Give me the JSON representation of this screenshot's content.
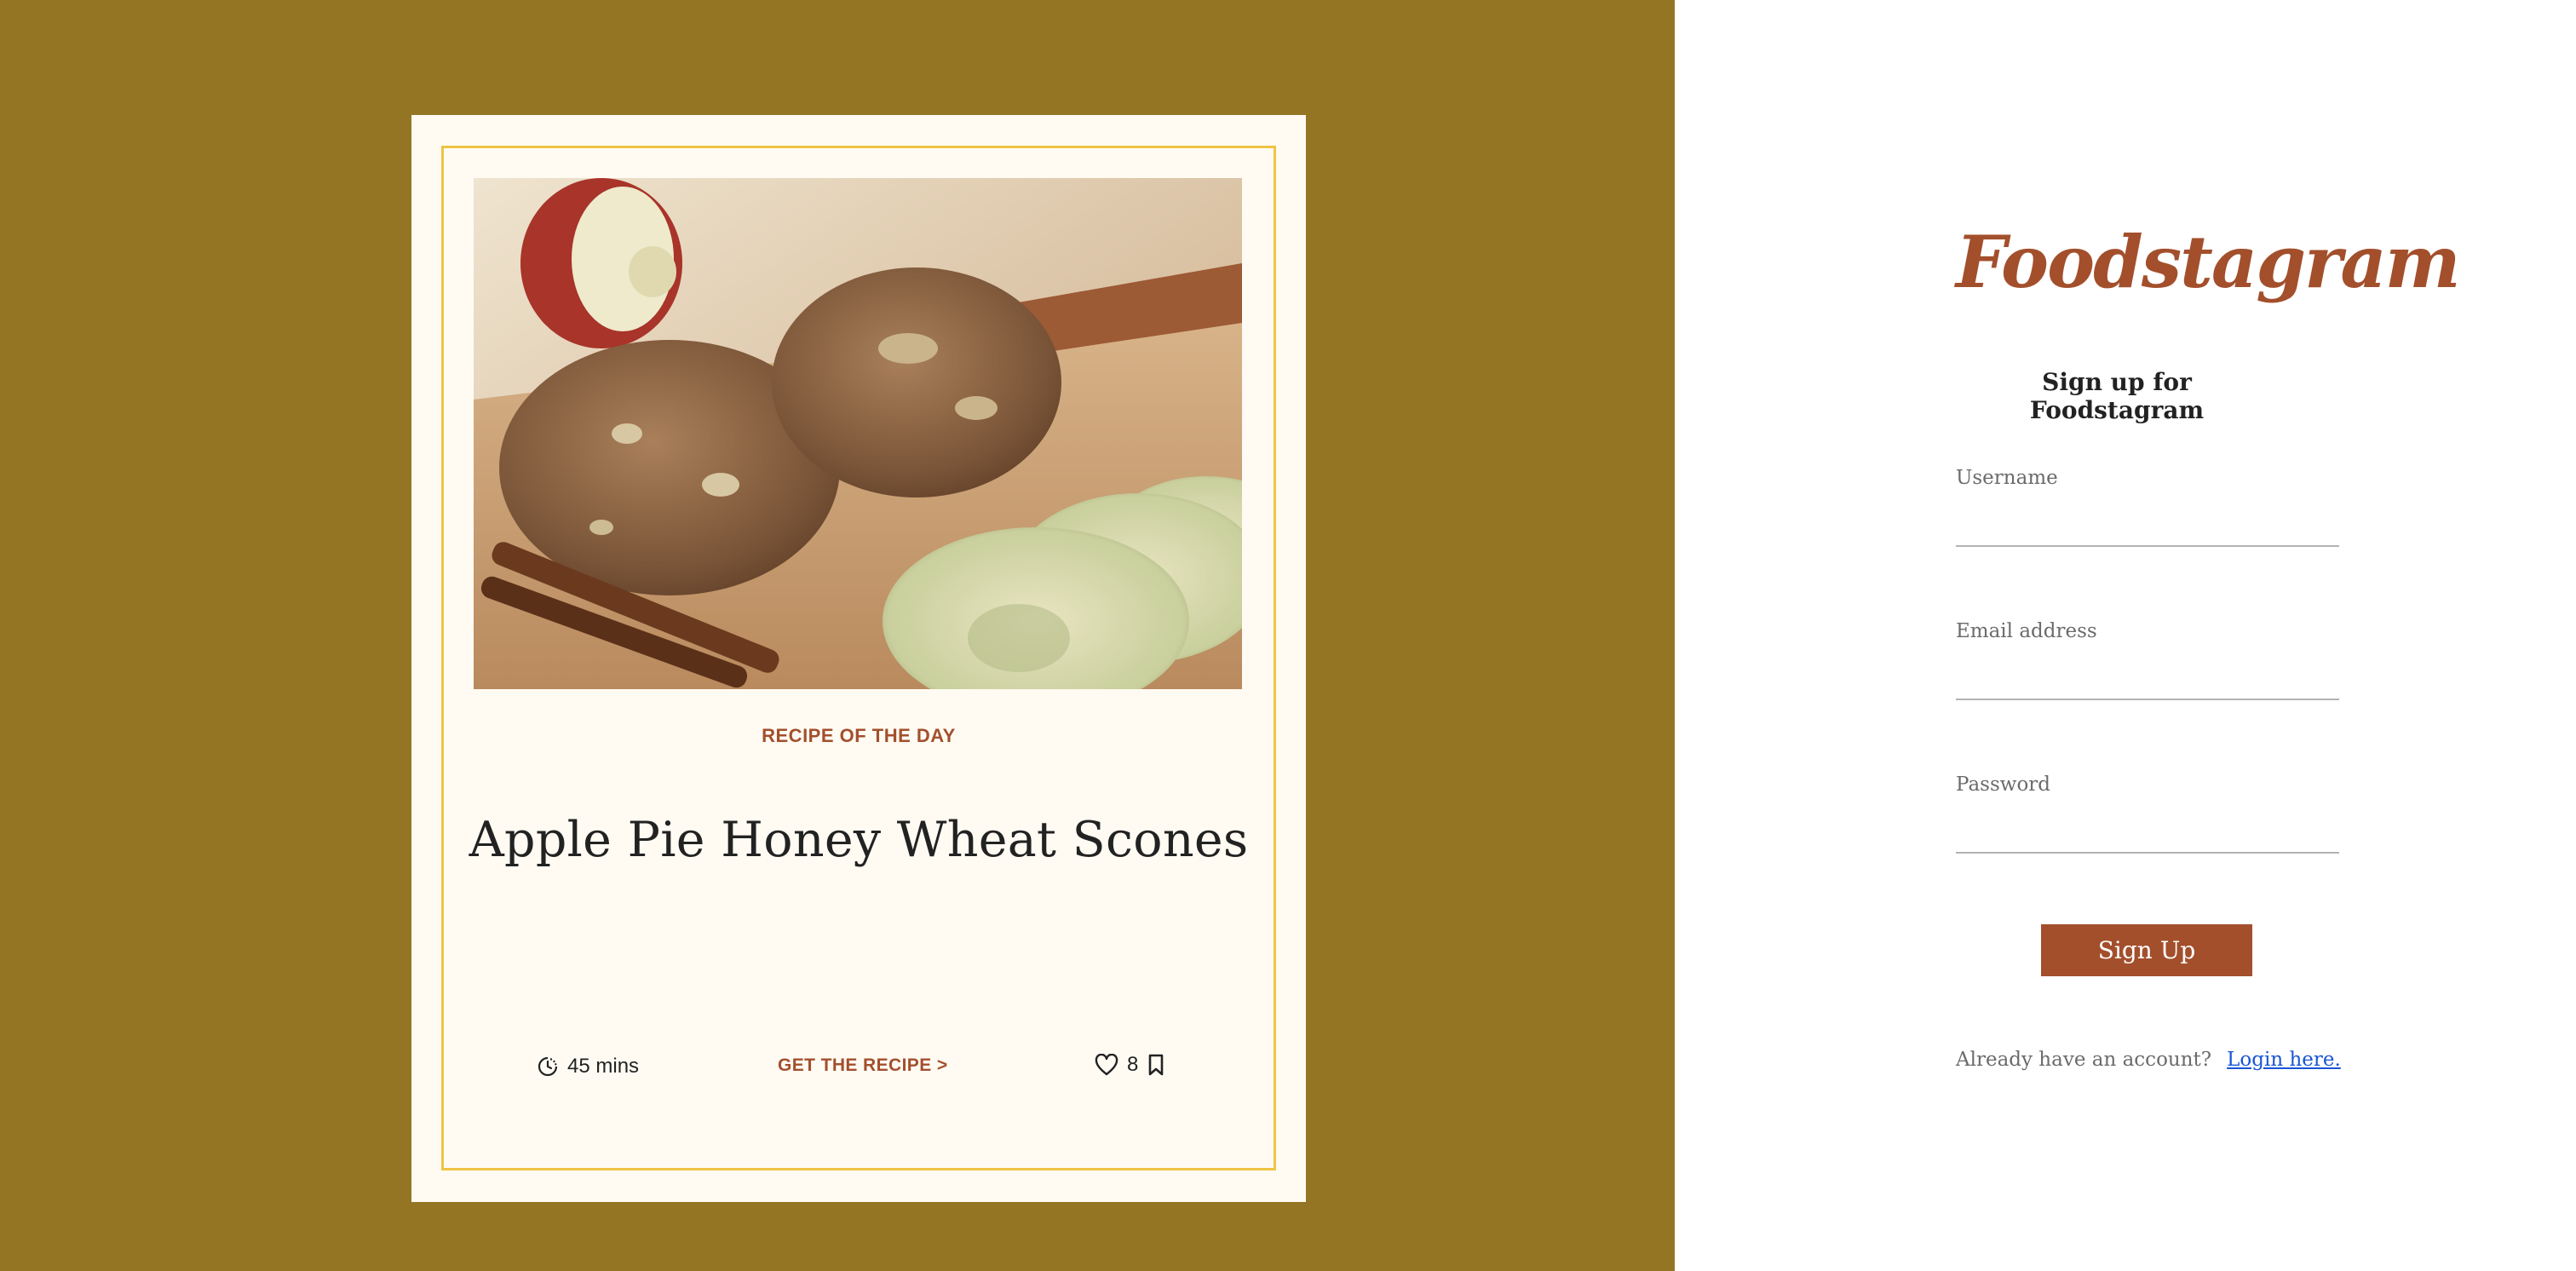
{
  "colors": {
    "left_background": "#947523",
    "card_background": "#fffbf3",
    "card_border": "#f0c343",
    "accent": "#a34f2c",
    "link": "#1a55d6"
  },
  "recipe_card": {
    "image_alt": "Apple Pie Honey Wheat Scones",
    "tag": "RECIPE OF THE DAY",
    "title": "Apple Pie Honey Wheat Scones",
    "time_icon": "clock-icon",
    "time": "45 mins",
    "cta": "GET THE RECIPE >",
    "like_icon": "heart-icon",
    "likes": "8",
    "save_icon": "bookmark-icon"
  },
  "signup": {
    "logo": "Foodstagram",
    "heading": "Sign up for Foodstagram",
    "fields": [
      {
        "label": "Username",
        "value": "",
        "placeholder": ""
      },
      {
        "label": "Email address",
        "value": "",
        "placeholder": ""
      },
      {
        "label": "Password",
        "value": "",
        "placeholder": ""
      }
    ],
    "submit_label": "Sign Up",
    "login_prompt": "Already have an account?",
    "login_link": "Login here."
  }
}
